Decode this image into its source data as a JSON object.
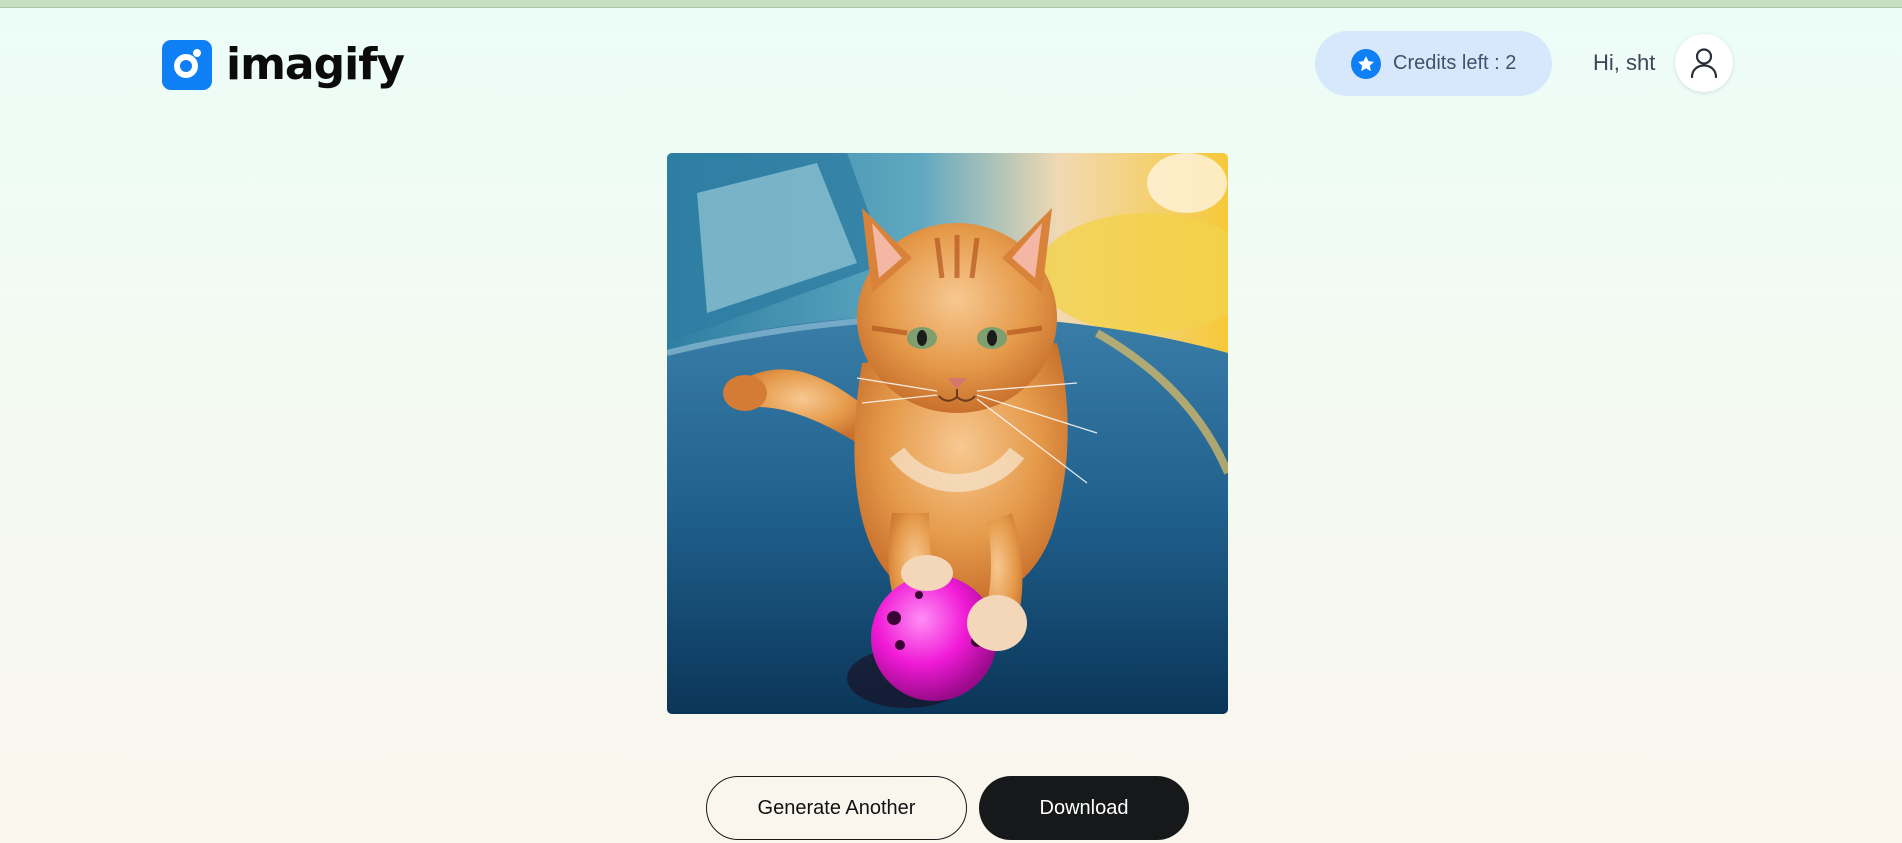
{
  "brand": {
    "name": "imagify",
    "logo_icon": "camera-lens-icon"
  },
  "header": {
    "credits_label": "Credits left : 2",
    "credits_icon": "star-icon",
    "greeting": "Hi, sht",
    "avatar_icon": "user-icon"
  },
  "result": {
    "image_subject": "generated-cat-image"
  },
  "actions": {
    "generate_another": "Generate Another",
    "download": "Download"
  },
  "colors": {
    "accent": "#0f7ff5",
    "credits_bg": "#d8e8fc",
    "download_bg": "#17181a"
  }
}
